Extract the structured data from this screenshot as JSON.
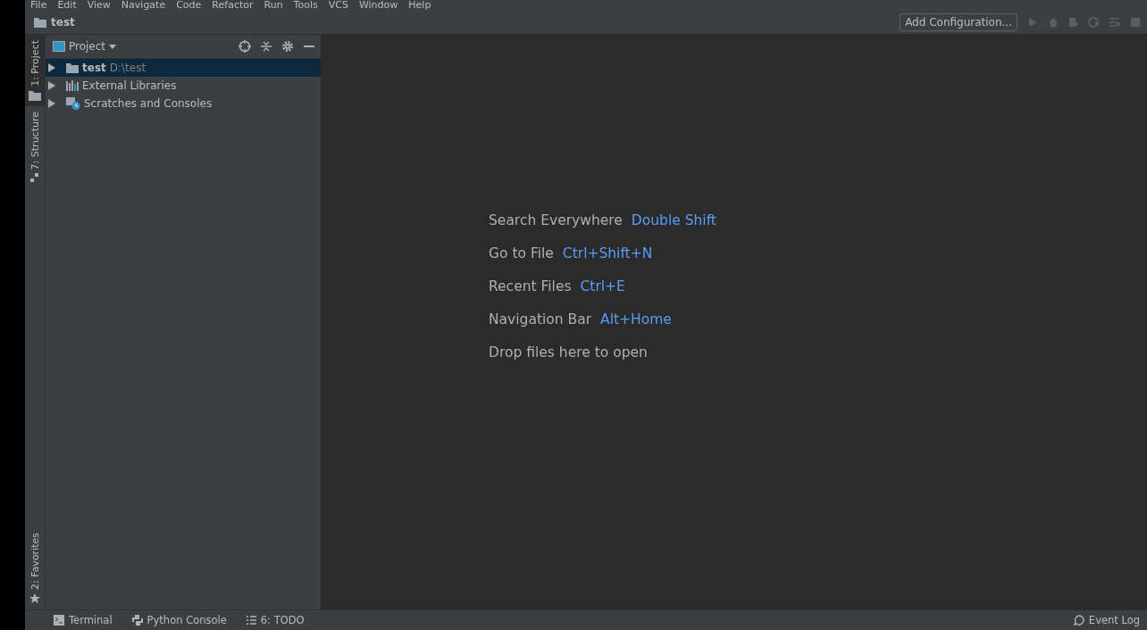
{
  "menu_bar": [
    "File",
    "Edit",
    "View",
    "Navigate",
    "Code",
    "Refactor",
    "Run",
    "Tools",
    "VCS",
    "Window",
    "Help"
  ],
  "navigation_bar": {
    "label": "test"
  },
  "toolbar": {
    "configuration_button": "Add Configuration..."
  },
  "left_stripe": {
    "top": [
      {
        "label": "1: Project",
        "kind": "folder",
        "selected": true
      },
      {
        "label": "7: Structure",
        "kind": "structure",
        "selected": false
      }
    ],
    "bottom": [
      {
        "label": "2: Favorites",
        "kind": "star",
        "selected": false
      }
    ]
  },
  "project_panel": {
    "title": "Project",
    "tree": [
      {
        "label": "test",
        "path": "D:\\test",
        "kind": "folder",
        "expanded": false,
        "selected": true
      },
      {
        "label": "External Libraries",
        "kind": "libraries",
        "expanded": false,
        "selected": false
      },
      {
        "label": "Scratches and Consoles",
        "kind": "scratches",
        "expanded": false,
        "selected": false
      }
    ]
  },
  "editor_hints": [
    {
      "action": "Search Everywhere",
      "shortcut": "Double Shift"
    },
    {
      "action": "Go to File",
      "shortcut": "Ctrl+Shift+N"
    },
    {
      "action": "Recent Files",
      "shortcut": "Ctrl+E"
    },
    {
      "action": "Navigation Bar",
      "shortcut": "Alt+Home"
    },
    {
      "action": "Drop files here to open"
    }
  ],
  "bottom_tool_windows": [
    {
      "label": "Terminal",
      "kind": "terminal"
    },
    {
      "label": "Python Console",
      "kind": "python"
    },
    {
      "label": "6: TODO",
      "kind": "todo"
    }
  ],
  "status_right": {
    "label": "Event Log"
  }
}
